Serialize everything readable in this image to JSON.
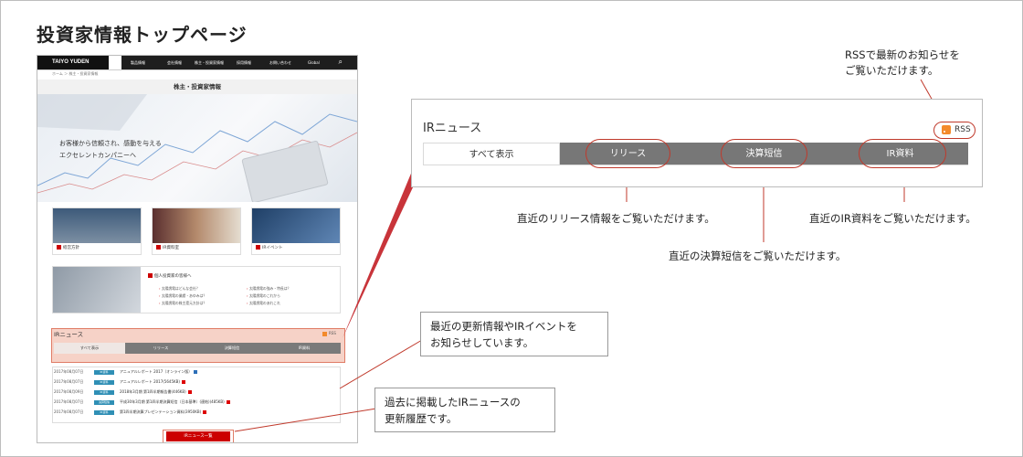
{
  "page": {
    "heading": "投資家情報トップページ"
  },
  "site": {
    "logo": "TAIYO YUDEN",
    "nav": [
      "製品情報",
      "会社情報",
      "株主・投資家情報",
      "採用情報",
      "お問い合わせ",
      "Global"
    ],
    "breadcrumb": "ホーム ＞ 株主・投資家情報",
    "page_title": "株主・投資家情報",
    "hero_text": [
      "お客様から信頼され、感動を与える",
      "エクセレントカンパニーへ"
    ],
    "cards": [
      "経営方針",
      "IR資料室",
      "IRイベント"
    ],
    "individual": {
      "title": "個人投資家の皆様へ",
      "left": [
        "太陽誘電はどんな会社？",
        "太陽誘電の業績・あゆみは？",
        "太陽誘電の株主還元方針は？"
      ],
      "right": [
        "太陽誘電の強み・特長は？",
        "太陽誘電のこれから",
        "太陽誘電のあれこれ"
      ]
    },
    "ir_news": {
      "title": "IRニュース",
      "rss": "RSS",
      "tabs": [
        "すべて表示",
        "リリース",
        "決算短信",
        "IR資料"
      ],
      "rows": [
        {
          "date": "2017年08月07日",
          "tag": "IR資料",
          "text": "アニュアルレポート 2017（オンライン版）"
        },
        {
          "date": "2017年08月07日",
          "tag": "IR資料",
          "text": "アニュアルレポート 2017(5645KB)"
        },
        {
          "date": "2017年08月09日",
          "tag": "IR資料",
          "text": "2018年3月期 第1四半期報告書(446KB)"
        },
        {
          "date": "2017年08月07日",
          "tag": "決算短信",
          "text": "平成30年3月期 第1四半期決算短信〔日本基準〕(連結)(485KB)"
        },
        {
          "date": "2017年08月07日",
          "tag": "IR資料",
          "text": "第1四半期決算プレゼンテーション資料(3950KB)"
        }
      ],
      "button": "IRニュース一覧"
    }
  },
  "panel": {
    "title": "IRニュース",
    "rss": "RSS",
    "tabs": [
      "すべて表示",
      "リリース",
      "決算短信",
      "IR資料"
    ]
  },
  "annotations": {
    "rss": "RSSで最新のお知らせを\nご覧いただけます。",
    "release": "直近のリリース情報をご覧いただけます。",
    "tanshin": "直近の決算短信をご覧いただけます。",
    "ir_docs": "直近のIR資料をご覧いただけます。",
    "ir_news": "最近の更新情報やIRイベントを\nお知らせしています。",
    "history": "過去に掲載したIRニュースの\n更新履歴です。"
  },
  "colors": {
    "accent": "#c0392b",
    "highlight": "#f6d2c7",
    "tab_dark": "#777777",
    "rss": "#f38a2b"
  }
}
